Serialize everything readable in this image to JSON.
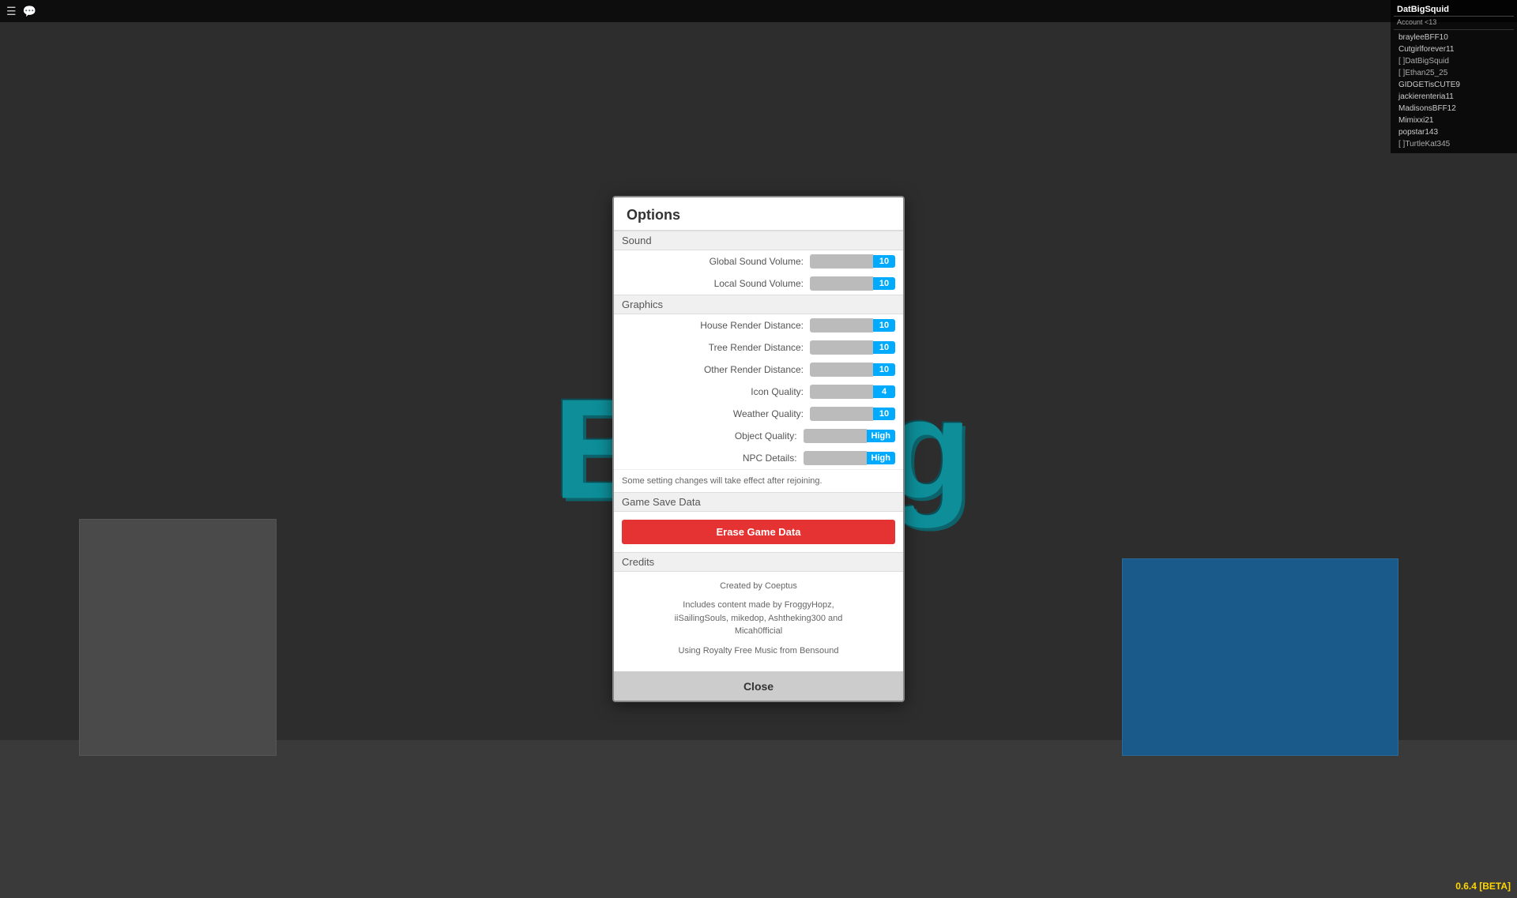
{
  "topbar": {
    "menu_icon": "☰",
    "chat_icon": "💬"
  },
  "right_panel": {
    "username": "DatBigSquid",
    "account_label": "Account <13",
    "players": [
      {
        "name": "brayleeBFF10",
        "bracket": false
      },
      {
        "name": "Cutgirlforever11",
        "bracket": false
      },
      {
        "name": "[ ]DatBigSquid",
        "bracket": true
      },
      {
        "name": "[ ]Ethan25_25",
        "bracket": true
      },
      {
        "name": "GIDGETisCUTE9",
        "bracket": false
      },
      {
        "name": "jackierenteria11",
        "bracket": false
      },
      {
        "name": "MadisonsBFF12",
        "bracket": false
      },
      {
        "name": "Mimixxi21",
        "bracket": false
      },
      {
        "name": "popstar143",
        "bracket": false
      },
      {
        "name": "[ ]TurtleKat345",
        "bracket": true
      }
    ]
  },
  "version": "0.6.4 [BETA]",
  "modal": {
    "title": "Options",
    "sections": {
      "sound": {
        "header": "Sound",
        "settings": [
          {
            "label": "Global Sound Volume:",
            "value": "10",
            "type": "slider"
          },
          {
            "label": "Local Sound Volume:",
            "value": "10",
            "type": "slider"
          }
        ]
      },
      "graphics": {
        "header": "Graphics",
        "settings": [
          {
            "label": "House Render Distance:",
            "value": "10",
            "type": "slider"
          },
          {
            "label": "Tree Render Distance:",
            "value": "10",
            "type": "slider"
          },
          {
            "label": "Other Render Distance:",
            "value": "10",
            "type": "slider"
          },
          {
            "label": "Icon Quality:",
            "value": "4",
            "type": "slider"
          },
          {
            "label": "Weather Quality:",
            "value": "10",
            "type": "slider"
          },
          {
            "label": "Object Quality:",
            "value": "High",
            "type": "text"
          },
          {
            "label": "NPC Details:",
            "value": "High",
            "type": "text"
          }
        ],
        "note": "Some setting changes will take effect after rejoining."
      },
      "game_save": {
        "header": "Game Save Data",
        "erase_label": "Erase Game Data"
      },
      "credits": {
        "header": "Credits",
        "lines": [
          "Created by Coeptus",
          "Includes content made by FroggyHopz,\niiSailingSouls, mikedop, Ashtheking300 and\nMicah0fficial",
          "Using Royalty Free Music from Bensound"
        ]
      }
    },
    "close_label": "Close"
  },
  "background": {
    "logo_text": "Bloxburg"
  }
}
